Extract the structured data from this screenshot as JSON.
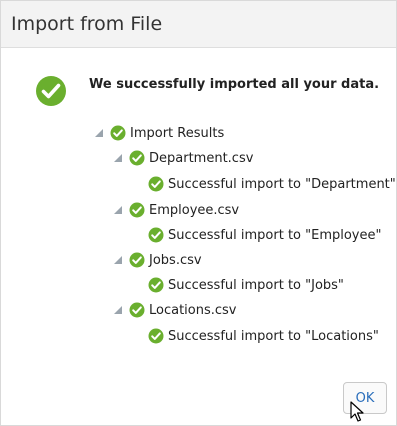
{
  "dialog": {
    "title": "Import from File",
    "message": "We successfully imported all your data."
  },
  "tree": {
    "root_label": "Import Results",
    "files": [
      {
        "label": "Department.csv",
        "result": "Successful import to \"Department\""
      },
      {
        "label": "Employee.csv",
        "result": "Successful import to \"Employee\""
      },
      {
        "label": "Jobs.csv",
        "result": "Successful import to \"Jobs\""
      },
      {
        "label": "Locations.csv",
        "result": "Successful import to \"Locations\""
      }
    ]
  },
  "buttons": {
    "ok_label": "OK"
  },
  "colors": {
    "success_green": "#6aaf2e",
    "arrow_gray": "#9aa4ad",
    "link_blue": "#2a6ebb"
  },
  "icons": {
    "success": "check-circle-icon",
    "expand": "expanded-arrow-icon",
    "pointer": "mouse-pointer-icon"
  }
}
